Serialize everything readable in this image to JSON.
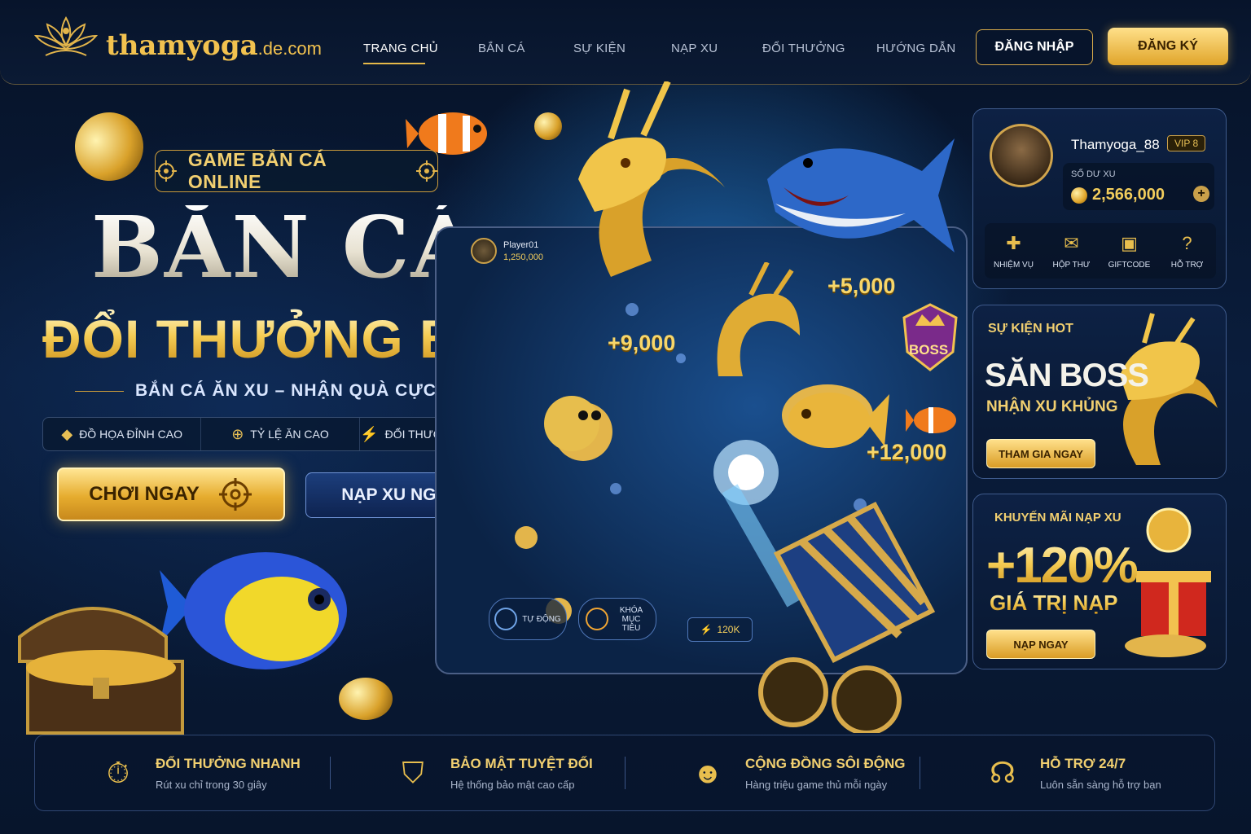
{
  "header": {
    "logo_main": "thamyoga",
    "logo_sub": ".de.com",
    "nav": [
      "TRANG CHỦ",
      "BẮN CÁ",
      "SỰ KIỆN",
      "NẠP XU",
      "ĐỔI THƯỞNG",
      "HƯỚNG DẪN"
    ],
    "login": "ĐĂNG NHẬP",
    "register": "ĐĂNG KÝ"
  },
  "hero": {
    "badge": "GAME BẮN CÁ ONLINE",
    "title": "BẮN CÁ",
    "subtitle": "ĐỔI THƯỞNG BANCA",
    "tagline": "BẮN CÁ ĂN XU – NHẬN QUÀ CỰC ĐÃ",
    "features": [
      "ĐỒ HỌA ĐỈNH CAO",
      "TỶ LỆ ĂN CAO",
      "ĐỔI THƯỞNG SIÊU TỐC"
    ],
    "play_button": "CHƠI NGAY",
    "topup_button": "NẠP XU NGAY"
  },
  "game": {
    "player_name": "Player01",
    "player_coins": "1,250,000",
    "rewards": [
      "+5,000",
      "+9,000",
      "+12,000"
    ],
    "boss": "BOSS",
    "auto": "TỰ ĐỘNG",
    "lock_target": "KHÓA MỤC TIÊU",
    "bet": "120K"
  },
  "profile": {
    "username": "Thamyoga_88",
    "vip": "VIP 8",
    "balance_label": "SỐ DƯ XU",
    "balance": "2,566,000",
    "quick": [
      "NHIỆM VỤ",
      "HỘP THƯ",
      "GIFTCODE",
      "HỖ TRỢ"
    ]
  },
  "event": {
    "label": "SỰ KIỆN HOT",
    "title": "SĂN BOSS",
    "subtitle": "NHẬN XU KHỦNG",
    "button": "THAM GIA NGAY"
  },
  "promo": {
    "label": "KHUYẾN MÃI NẠP XU",
    "percent": "+120%",
    "subtitle": "GIÁ TRỊ NẠP",
    "button": "NẠP NGAY"
  },
  "bottom": [
    {
      "title": "ĐỔI THƯỞNG NHANH",
      "desc": "Rút xu chỉ trong 30 giây"
    },
    {
      "title": "BẢO MẬT TUYỆT ĐỐI",
      "desc": "Hệ thống bảo mật cao cấp"
    },
    {
      "title": "CỘNG ĐỒNG SÔI ĐỘNG",
      "desc": "Hàng triệu game thủ mỗi ngày"
    },
    {
      "title": "HỖ TRỢ 24/7",
      "desc": "Luôn sẵn sàng hỗ trợ bạn"
    }
  ],
  "colors": {
    "gold": "#e8be4e",
    "navy": "#0b1a34",
    "accent_blue": "#1c3e7c"
  }
}
